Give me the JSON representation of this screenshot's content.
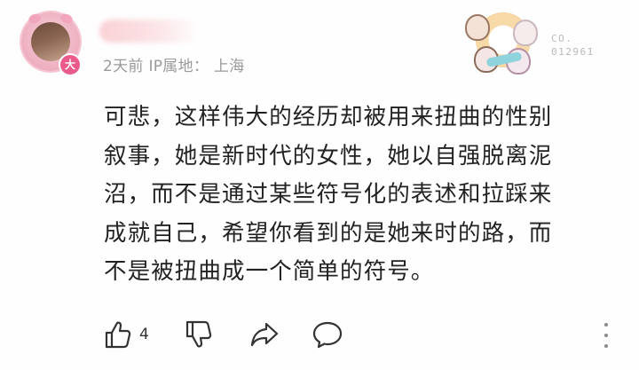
{
  "comment": {
    "author": {
      "username": "",
      "badge_text": "大"
    },
    "meta": {
      "time": "2天前",
      "ip_location_label": "IP属地：",
      "ip_location": "上海"
    },
    "decoration": {
      "code_line1": "CO.",
      "code_line2": "012961"
    },
    "body_lines": [
      "可悲，这样伟大的经历却被用来扭曲的性别",
      "叙事，她是新时代的女性，她以自强脱离泥",
      "沼，而不是通过某些符号化的表述和拉踩来",
      "成就自己，希望你看到的是她来时的路，而",
      "不是被扭曲成一个简单的符号。"
    ],
    "actions": {
      "like_count": "4"
    }
  },
  "colors": {
    "text": "#222222",
    "meta": "#9a9a9a",
    "icon": "#333333",
    "badge": "#ea5a8a"
  }
}
